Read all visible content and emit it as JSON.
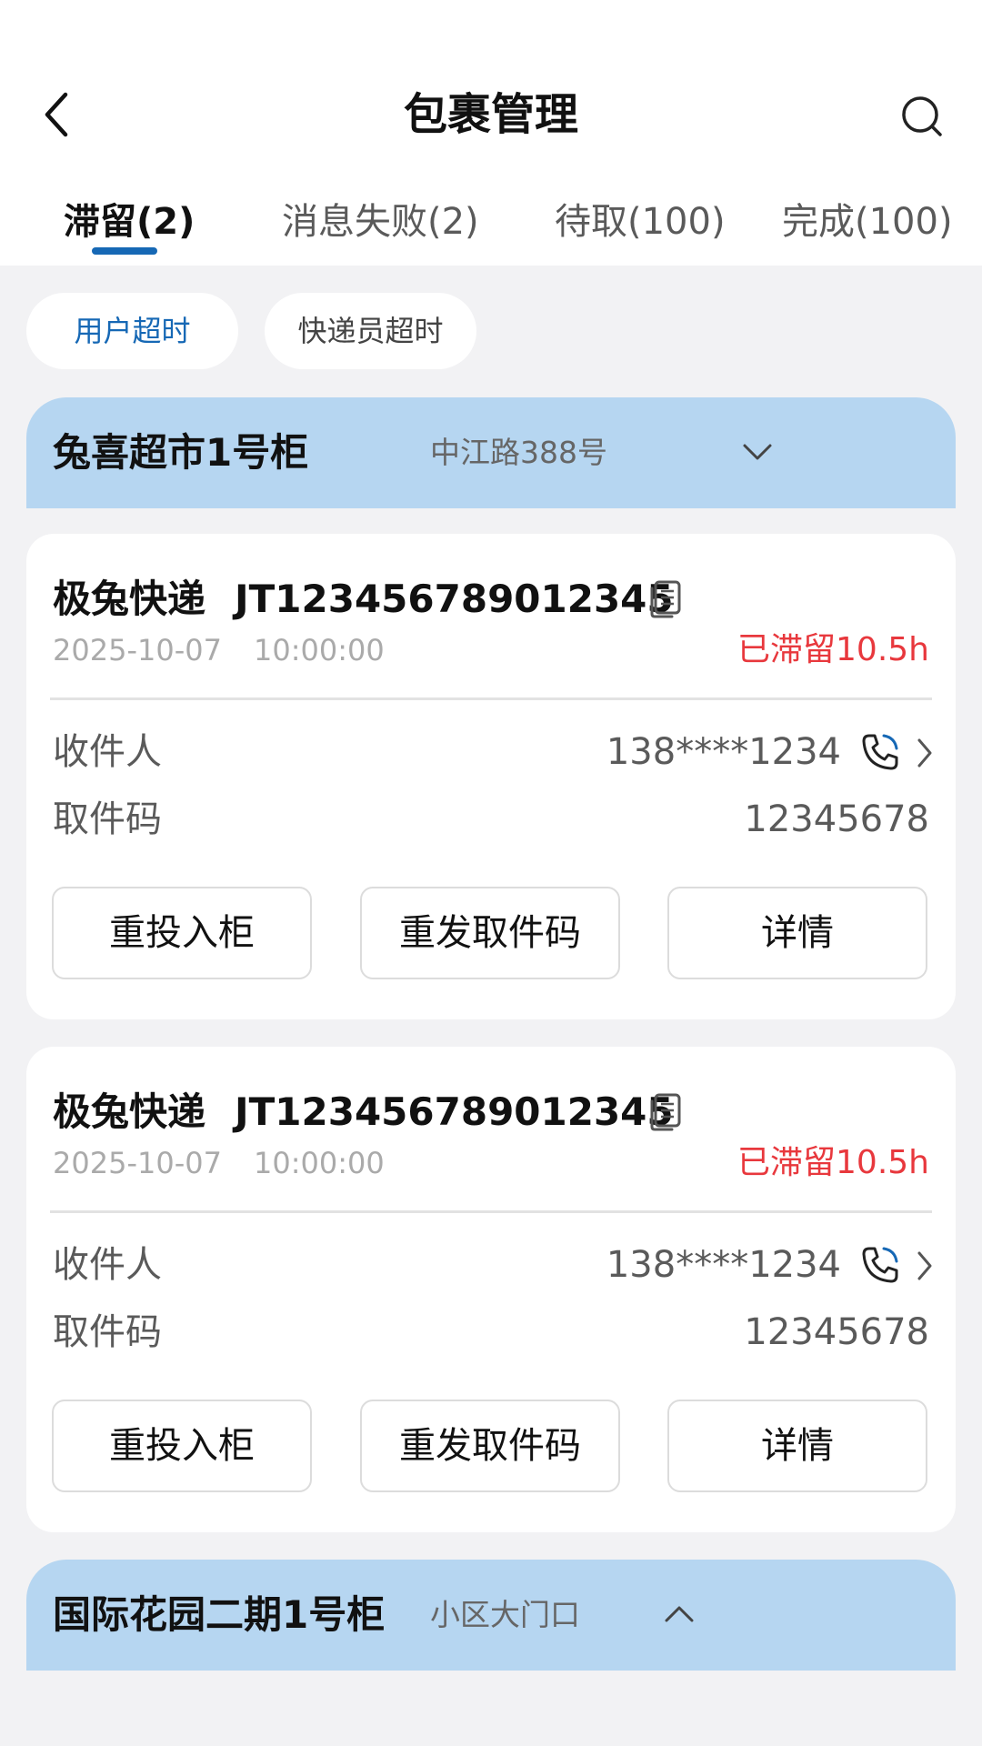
{
  "header": {
    "title": "包裹管理",
    "back_icon": "chevron-left-icon",
    "search_icon": "search-icon"
  },
  "tabs": [
    {
      "label": "滞留(2)",
      "active": true
    },
    {
      "label": "消息失败(2)",
      "active": false
    },
    {
      "label": "待取(100)",
      "active": false
    },
    {
      "label": "完成(100)",
      "active": false
    }
  ],
  "filters": [
    {
      "label": "用户超时",
      "active": true
    },
    {
      "label": "快递员超时",
      "active": false
    }
  ],
  "groups": [
    {
      "name": "兔喜超市1号柜",
      "address": "中江路388号",
      "expanded": true,
      "packages": [
        {
          "company": "极兔快递",
          "tracking": "JT123456789012345",
          "date": "2025-10-07",
          "time": "10:00:00",
          "status": "已滞留10.5h",
          "recipient_label": "收件人",
          "phone": "138****1234",
          "code_label": "取件码",
          "code": "12345678",
          "actions": [
            "重投入柜",
            "重发取件码",
            "详情"
          ]
        },
        {
          "company": "极兔快递",
          "tracking": "JT123456789012345",
          "date": "2025-10-07",
          "time": "10:00:00",
          "status": "已滞留10.5h",
          "recipient_label": "收件人",
          "phone": "138****1234",
          "code_label": "取件码",
          "code": "12345678",
          "actions": [
            "重投入柜",
            "重发取件码",
            "详情"
          ]
        }
      ]
    },
    {
      "name": "国际花园二期1号柜",
      "address": "小区大门口",
      "expanded": false
    }
  ],
  "colors": {
    "accent": "#1668b5",
    "group_header_bg": "#b6d6f1",
    "status_red": "#e8383d",
    "page_bg": "#f2f2f4"
  }
}
